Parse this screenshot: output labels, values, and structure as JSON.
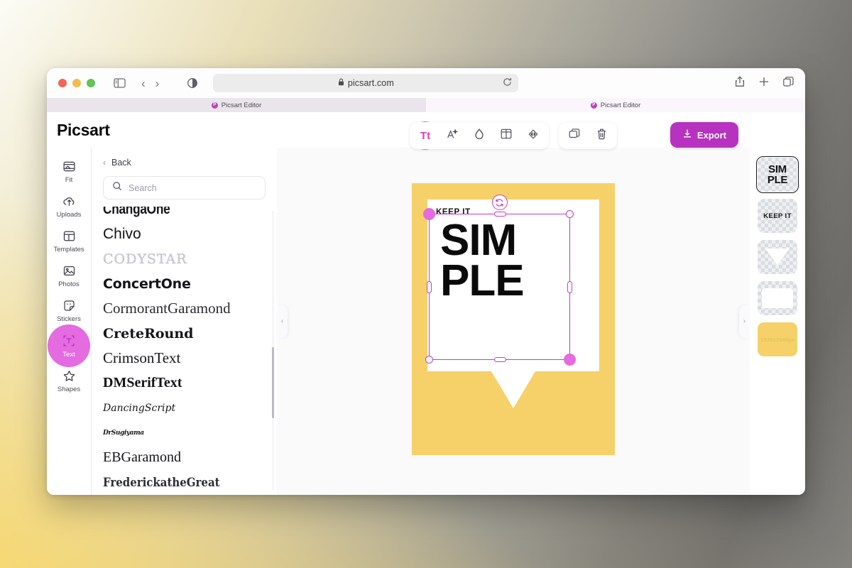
{
  "browser": {
    "url": "picsart.com",
    "lock_icon": "lock-icon",
    "reload_icon": "reload-icon",
    "sidebar_icon": "sidebar-toggle-icon",
    "back_icon": "back-chevron-icon",
    "forward_icon": "forward-chevron-icon",
    "shield_icon": "privacy-shield-icon",
    "share_icon": "share-icon",
    "new_tab_icon": "plus-icon",
    "tab_overview_icon": "tab-overview-icon",
    "tabs": [
      {
        "title": "Picsart Editor",
        "active": false
      },
      {
        "title": "Picsart Editor",
        "active": true
      }
    ]
  },
  "app": {
    "logo": "Picsart",
    "rail": [
      {
        "label": "Fit",
        "icon": "fit-icon",
        "active": false
      },
      {
        "label": "Uploads",
        "icon": "upload-cloud-icon",
        "active": false
      },
      {
        "label": "Templates",
        "icon": "templates-grid-icon",
        "active": false
      },
      {
        "label": "Photos",
        "icon": "photo-icon",
        "active": false
      },
      {
        "label": "Stickers",
        "icon": "sticker-icon",
        "active": false
      },
      {
        "label": "Text",
        "icon": "text-box-icon",
        "active": true
      },
      {
        "label": "Shapes",
        "icon": "star-shape-icon",
        "active": false
      }
    ],
    "panel": {
      "back_label": "Back",
      "back_icon": "chevron-left-icon",
      "search_placeholder": "Search",
      "search_value": "",
      "search_icon": "search-icon",
      "fonts": [
        {
          "name": "ChangaOne",
          "style": "heavy-condensed"
        },
        {
          "name": "Chivo",
          "style": "sans"
        },
        {
          "name": "CODYSTAR",
          "style": "dotted-outline"
        },
        {
          "name": "ConcertOne",
          "style": "bold-sans"
        },
        {
          "name": "CormorantGaramond",
          "style": "serif-light"
        },
        {
          "name": "CreteRound",
          "style": "slab-bold"
        },
        {
          "name": "CrimsonText",
          "style": "serif"
        },
        {
          "name": "DMSerifText",
          "style": "serif-bold"
        },
        {
          "name": "DancingScript",
          "style": "script"
        },
        {
          "name": "DrSugiyama",
          "style": "script-tiny"
        },
        {
          "name": "EBGaramond",
          "style": "serif"
        },
        {
          "name": "FrederickatheGreat",
          "style": "serif-sketch"
        }
      ]
    },
    "collapse_left_icon": "collapse-left-chevron-icon",
    "collapse_right_icon": "collapse-right-chevron-icon",
    "toolbar": {
      "group1": [
        {
          "name": "font-style-button",
          "icon": "Tt",
          "active": true
        },
        {
          "name": "text-effects-button",
          "icon": "a-sparkle-icon",
          "active": false
        },
        {
          "name": "text-color-button",
          "icon": "droplet-icon",
          "active": false
        },
        {
          "name": "text-align-button",
          "icon": "align-grid-icon",
          "active": false
        },
        {
          "name": "blend-button",
          "icon": "diamond-arrows-icon",
          "active": false
        }
      ],
      "group2": [
        {
          "name": "duplicate-layer-button",
          "icon": "copy-icon",
          "active": false
        },
        {
          "name": "delete-layer-button",
          "icon": "trash-icon",
          "active": false
        }
      ]
    },
    "export": {
      "label": "Export",
      "icon": "download-icon",
      "color": "#b832c0"
    },
    "canvas": {
      "background_color": "#f6d169",
      "bubble_color": "#ffffff",
      "eyebrow_text": "KEEP IT",
      "headline_line1": "SIM",
      "headline_line2": "PLE",
      "selection_color": "#c13fc1",
      "handle_color": "#e56be0",
      "rotate_icon": "rotate-icon"
    },
    "layers": [
      {
        "name": "SIMPLE text layer",
        "kind": "text",
        "text": "SIM\nPLE",
        "selected": true
      },
      {
        "name": "KEEP IT text layer",
        "kind": "text",
        "text": "KEEP IT",
        "selected": false
      },
      {
        "name": "Triangle tail shape",
        "kind": "shape",
        "text": "",
        "selected": false
      },
      {
        "name": "White rectangle",
        "kind": "shape",
        "text": "",
        "selected": false
      },
      {
        "name": "Background",
        "kind": "bg",
        "text": "1536x2048px",
        "selected": false
      }
    ]
  }
}
